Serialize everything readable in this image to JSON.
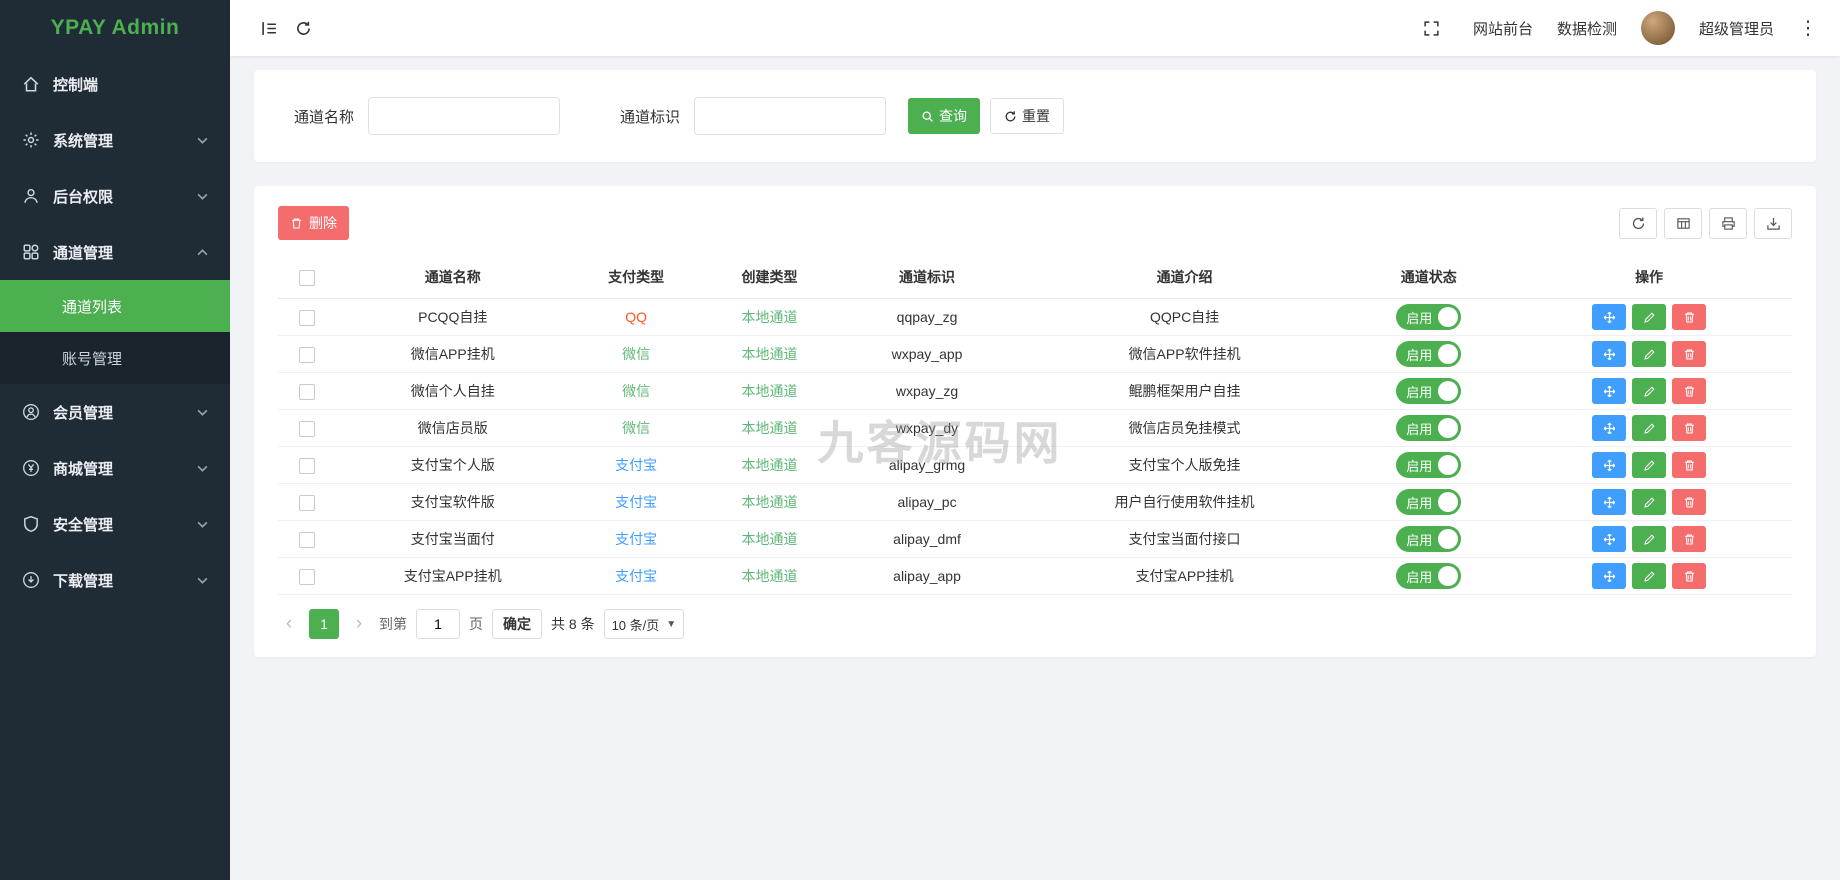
{
  "watermark": "九客源码网",
  "sidebar": {
    "logo": "YPAY Admin",
    "items": [
      {
        "label": "控制端",
        "icon": "home-icon"
      },
      {
        "label": "系统管理",
        "icon": "gear-icon",
        "chevron": "down"
      },
      {
        "label": "后台权限",
        "icon": "user-icon",
        "chevron": "down"
      },
      {
        "label": "通道管理",
        "icon": "category-icon",
        "chevron": "up",
        "open": true,
        "children": [
          {
            "label": "通道列表",
            "active": true
          },
          {
            "label": "账号管理",
            "active": false
          }
        ]
      },
      {
        "label": "会员管理",
        "icon": "member-icon",
        "chevron": "down"
      },
      {
        "label": "商城管理",
        "icon": "shop-icon",
        "chevron": "down"
      },
      {
        "label": "安全管理",
        "icon": "shield-icon",
        "chevron": "down"
      },
      {
        "label": "下载管理",
        "icon": "download-icon",
        "chevron": "down"
      }
    ]
  },
  "topbar": {
    "frontend_link": "网站前台",
    "data_check_link": "数据检测",
    "username": "超级管理员"
  },
  "filters": {
    "name_label": "通道名称",
    "code_label": "通道标识",
    "search_button": "查询",
    "reset_button": "重置"
  },
  "table": {
    "delete_button": "删除",
    "columns": [
      "通道名称",
      "支付类型",
      "创建类型",
      "通道标识",
      "通道介绍",
      "通道状态",
      "操作"
    ],
    "rows": [
      {
        "name": "PCQQ自挂",
        "pay_type": "QQ",
        "pay_type_color": "#ff5722",
        "create_type": "本地通道",
        "code": "qqpay_zg",
        "intro": "QQPC自挂",
        "status": "启用"
      },
      {
        "name": "微信APP挂机",
        "pay_type": "微信",
        "pay_type_color": "#5fb878",
        "create_type": "本地通道",
        "code": "wxpay_app",
        "intro": "微信APP软件挂机",
        "status": "启用"
      },
      {
        "name": "微信个人自挂",
        "pay_type": "微信",
        "pay_type_color": "#5fb878",
        "create_type": "本地通道",
        "code": "wxpay_zg",
        "intro": "鲲鹏框架用户自挂",
        "status": "启用"
      },
      {
        "name": "微信店员版",
        "pay_type": "微信",
        "pay_type_color": "#5fb878",
        "create_type": "本地通道",
        "code": "wxpay_dy",
        "intro": "微信店员免挂模式",
        "status": "启用"
      },
      {
        "name": "支付宝个人版",
        "pay_type": "支付宝",
        "pay_type_color": "#409eff",
        "create_type": "本地通道",
        "code": "alipay_grmg",
        "intro": "支付宝个人版免挂",
        "status": "启用"
      },
      {
        "name": "支付宝软件版",
        "pay_type": "支付宝",
        "pay_type_color": "#409eff",
        "create_type": "本地通道",
        "code": "alipay_pc",
        "intro": "用户自行使用软件挂机",
        "status": "启用"
      },
      {
        "name": "支付宝当面付",
        "pay_type": "支付宝",
        "pay_type_color": "#409eff",
        "create_type": "本地通道",
        "code": "alipay_dmf",
        "intro": "支付宝当面付接口",
        "status": "启用"
      },
      {
        "name": "支付宝APP挂机",
        "pay_type": "支付宝",
        "pay_type_color": "#409eff",
        "create_type": "本地通道",
        "code": "alipay_app",
        "intro": "支付宝APP挂机",
        "status": "启用"
      }
    ]
  },
  "pagination": {
    "current_page": "1",
    "goto_label": "到第",
    "goto_value": "1",
    "page_unit": "页",
    "confirm_button": "确定",
    "total_label": "共 8 条",
    "page_size": "10 条/页"
  },
  "colors": {
    "accent_green": "#4caf50",
    "local_channel_green": "#5fb878",
    "qq_red": "#ff5722",
    "alipay_blue": "#409eff",
    "action_red": "#f56c6c",
    "sidebar_dark": "#1f2b35"
  }
}
